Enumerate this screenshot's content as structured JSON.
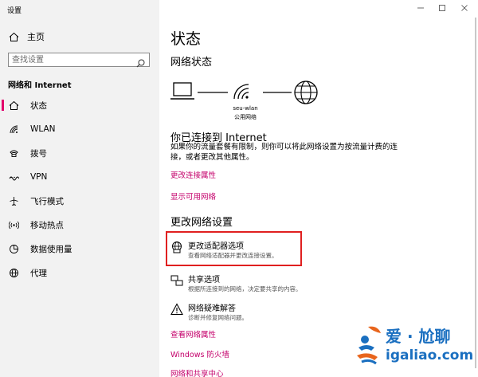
{
  "window": {
    "title": "设置"
  },
  "sidebar": {
    "home_label": "主页",
    "search_placeholder": "查找设置",
    "section_title": "网络和 Internet",
    "items": [
      {
        "label": "状态",
        "icon": "home-status-icon",
        "active": true
      },
      {
        "label": "WLAN",
        "icon": "wifi-icon"
      },
      {
        "label": "拨号",
        "icon": "dialup-icon"
      },
      {
        "label": "VPN",
        "icon": "vpn-icon"
      },
      {
        "label": "飞行模式",
        "icon": "airplane-icon"
      },
      {
        "label": "移动热点",
        "icon": "hotspot-icon"
      },
      {
        "label": "数据使用量",
        "icon": "data-usage-icon"
      },
      {
        "label": "代理",
        "icon": "globe-icon"
      }
    ]
  },
  "main": {
    "title": "状态",
    "network_status_heading": "网络状态",
    "network": {
      "name": "seu-wlan",
      "type": "公用网络"
    },
    "connected_title": "你已连接到 Internet",
    "connected_desc": "如果你的流量套餐有限制，则你可以将此网络设置为按流量计费的连接，或者更改其他属性。",
    "link_change_props": "更改连接属性",
    "link_show_networks": "显示可用网络",
    "change_settings_heading": "更改网络设置",
    "options": [
      {
        "title": "更改适配器选项",
        "desc": "查看网络适配器并更改连接设置。",
        "icon": "adapter-icon"
      },
      {
        "title": "共享选项",
        "desc": "根据所连接到的网络，决定要共享的内容。",
        "icon": "sharing-icon"
      },
      {
        "title": "网络疑难解答",
        "desc": "诊断并修复网络问题。",
        "icon": "warning-icon"
      }
    ],
    "links": [
      "查看网络属性",
      "Windows 防火墙",
      "网络和共享中心"
    ]
  },
  "watermark": {
    "brand": "爱 · 尬聊",
    "site": "igaliao.com"
  },
  "colors": {
    "accent": "#c4006b",
    "highlight_box": "#e02020",
    "watermark": "#1a6fc0"
  }
}
